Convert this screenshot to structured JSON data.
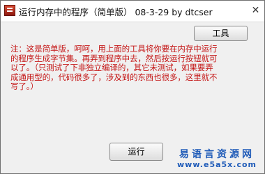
{
  "window": {
    "title": "运行内存中的程序（简单版） 08-3-29 by dtcser",
    "close_label": "✕"
  },
  "toolbar": {
    "tools_label": "工具"
  },
  "notice": {
    "lines": [
      "注：这是简单版，呵呵，用上面的工具将你要在内存中运行",
      "的程序生成字节集。再弄到程序中去，然后按运行按钮就可",
      "以了。（只测试了下非独立编译的，其它未测试，如果要弄",
      "成通用型的，代码很多了，涉及到的东西也很多，这里就不",
      "写了。）"
    ],
    "color": "#c41414"
  },
  "actions": {
    "run_label": "运行"
  },
  "watermark": {
    "line1": "易语言资源网",
    "line2": "www.e5a5x.com",
    "color": "#1f5bb8"
  }
}
